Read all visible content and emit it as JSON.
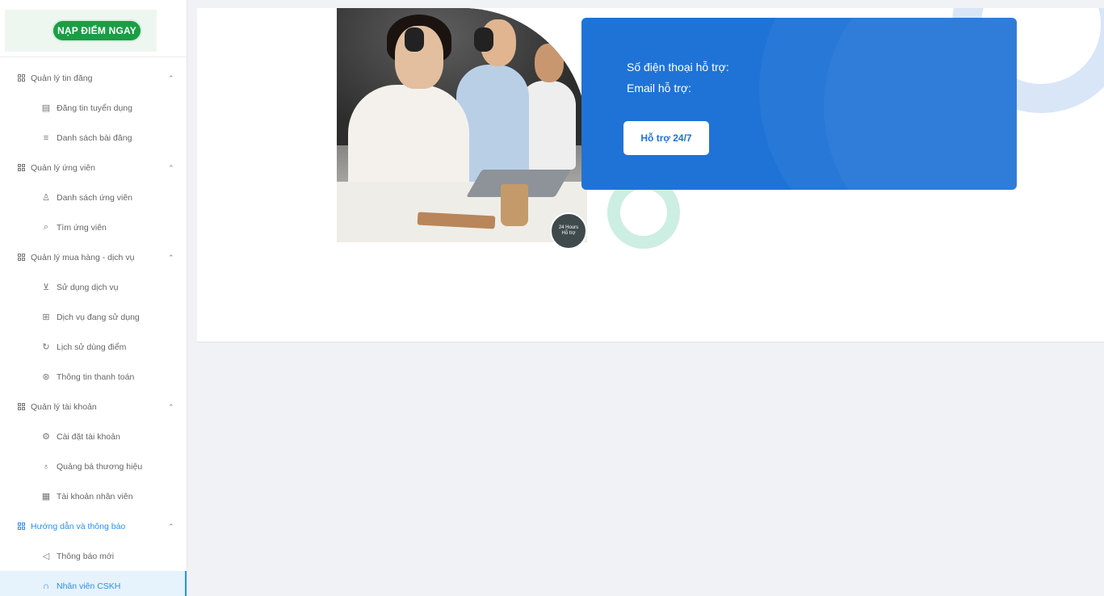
{
  "sidebar": {
    "topup_button": "NẠP ĐIỂM NGAY",
    "groups": [
      {
        "label": "Quản lý tin đăng",
        "items": [
          {
            "label": "Đăng tin tuyển dụng",
            "icon": "document-icon"
          },
          {
            "label": "Danh sách bài đăng",
            "icon": "list-icon"
          }
        ]
      },
      {
        "label": "Quản lý ứng viên",
        "items": [
          {
            "label": "Danh sách ứng viên",
            "icon": "user-icon"
          },
          {
            "label": "Tìm ứng viên",
            "icon": "search-icon"
          }
        ]
      },
      {
        "label": "Quản lý mua hàng - dịch vụ",
        "items": [
          {
            "label": "Sử dụng dịch vụ",
            "icon": "cart-icon"
          },
          {
            "label": "Dịch vụ đang sử dụng",
            "icon": "service-icon"
          },
          {
            "label": "Lịch sử dùng điểm",
            "icon": "history-icon"
          },
          {
            "label": "Thông tin thanh toán",
            "icon": "payment-icon"
          }
        ]
      },
      {
        "label": "Quản lý tài khoản",
        "items": [
          {
            "label": "Cài đặt tài khoản",
            "icon": "user-settings-icon"
          },
          {
            "label": "Quảng bá thương hiệu",
            "icon": "brand-icon"
          },
          {
            "label": "Tài khoản nhân viên",
            "icon": "staff-icon"
          }
        ]
      },
      {
        "label": "Hướng dẫn và thông báo",
        "items": [
          {
            "label": "Thông báo mới",
            "icon": "megaphone-icon"
          },
          {
            "label": "Nhân viên CSKH",
            "icon": "headset-icon"
          }
        ]
      }
    ]
  },
  "support": {
    "phone_label": "Số điện thoại hỗ trợ:",
    "email_label": "Email hỗ trợ:",
    "button": "Hỗ trợ 24/7",
    "badge_line1": "24 Hours",
    "badge_line2": "Hỗ trợ"
  },
  "colors": {
    "accent": "#2a8ff0",
    "brand_green": "#1a9e45",
    "support_blue": "#1f73d6"
  }
}
